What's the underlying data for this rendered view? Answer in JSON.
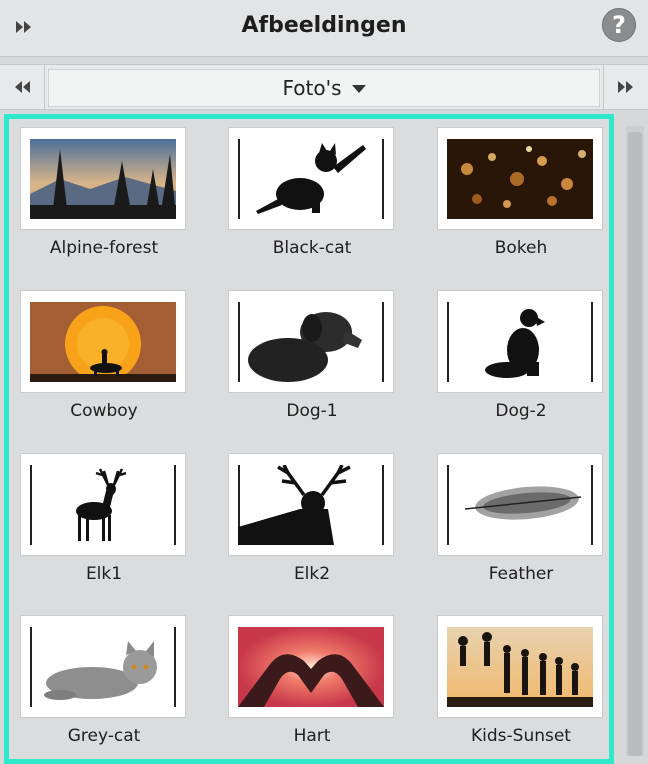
{
  "header": {
    "title": "Afbeeldingen",
    "help_label": "?"
  },
  "nav": {
    "category": "Foto's"
  },
  "thumbnails": [
    {
      "label": "Alpine-forest",
      "image": "alpine-forest-photo"
    },
    {
      "label": "Black-cat",
      "image": "black-cat-silhouette"
    },
    {
      "label": "Bokeh",
      "image": "bokeh-lights-photo"
    },
    {
      "label": "Cowboy",
      "image": "cowboy-sunset-photo"
    },
    {
      "label": "Dog-1",
      "image": "dog-photo"
    },
    {
      "label": "Dog-2",
      "image": "dog-silhouette"
    },
    {
      "label": "Elk1",
      "image": "elk-silhouette"
    },
    {
      "label": "Elk2",
      "image": "elk-head-silhouette"
    },
    {
      "label": "Feather",
      "image": "feather-photo"
    },
    {
      "label": "Grey-cat",
      "image": "grey-cat-photo"
    },
    {
      "label": "Hart",
      "image": "heart-hands-photo"
    },
    {
      "label": "Kids-Sunset",
      "image": "kids-sunset-photo"
    }
  ],
  "colors": {
    "selection_border": "#2ee8cc",
    "panel_bg": "#dadcde"
  }
}
